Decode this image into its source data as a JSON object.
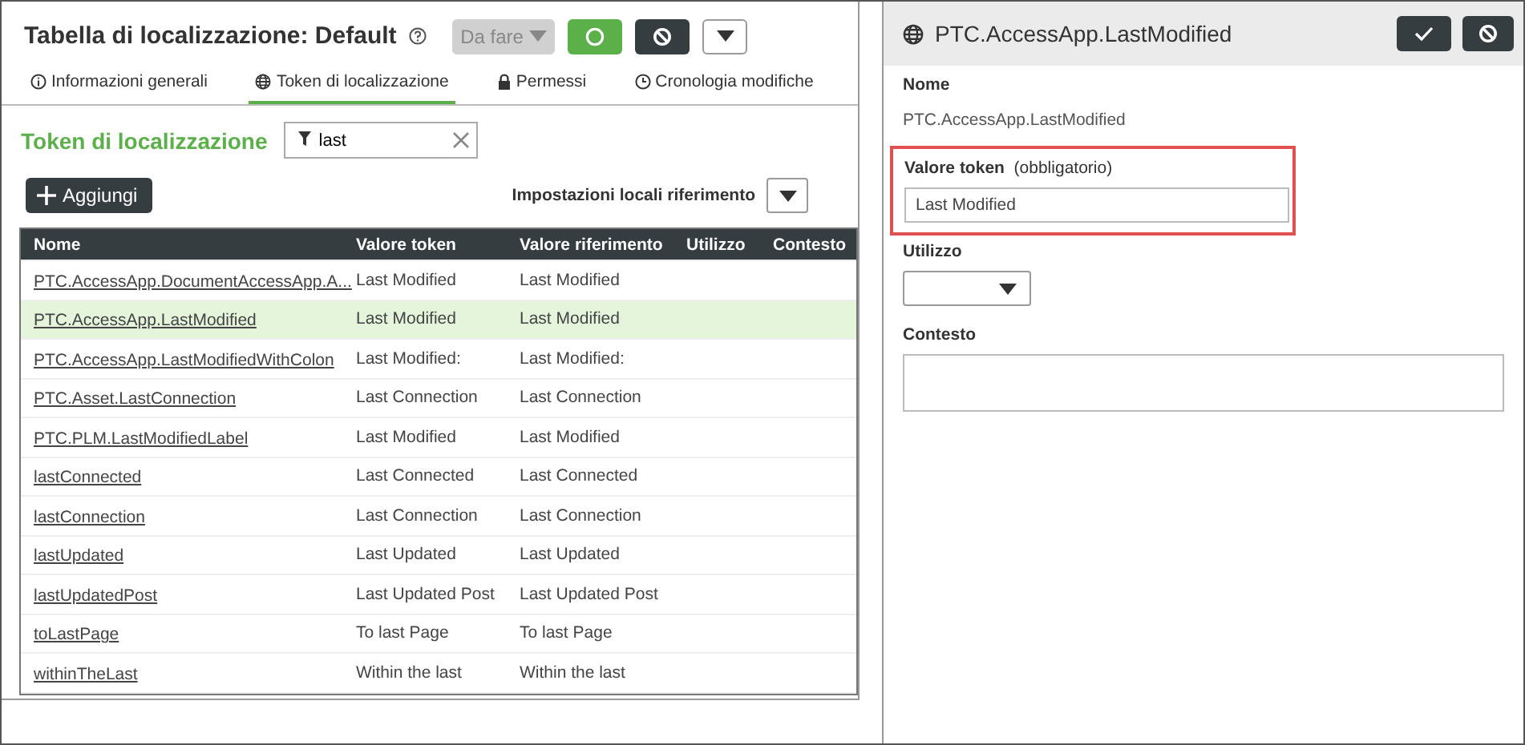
{
  "header": {
    "title": "Tabella di localizzazione: Default",
    "status": {
      "label": "Da fare",
      "disabled": true
    }
  },
  "tabs": [
    {
      "label": "Informazioni generali",
      "selected": false
    },
    {
      "label": "Token di localizzazione",
      "selected": true
    },
    {
      "label": "Permessi",
      "selected": false
    },
    {
      "label": "Cronologia modifiche",
      "selected": false
    }
  ],
  "section_title": "Token di localizzazione",
  "filter": {
    "value": "last"
  },
  "add_button": "Aggiungi",
  "reference_locale": {
    "label": "Impostazioni locali riferimento"
  },
  "table": {
    "columns": [
      "Nome",
      "Valore token",
      "Valore riferimento",
      "Utilizzo",
      "Contesto"
    ],
    "rows": [
      {
        "name": "PTC.AccessApp.DocumentAccessApp.A...",
        "token_value": "Last Modified",
        "reference_value": "Last Modified",
        "selected": false
      },
      {
        "name": "PTC.AccessApp.LastModified",
        "token_value": "Last Modified",
        "reference_value": "Last Modified",
        "selected": true
      },
      {
        "name": "PTC.AccessApp.LastModifiedWithColon",
        "token_value": "Last Modified:",
        "reference_value": "Last Modified:",
        "selected": false
      },
      {
        "name": "PTC.Asset.LastConnection",
        "token_value": "Last Connection",
        "reference_value": "Last Connection",
        "selected": false
      },
      {
        "name": "PTC.PLM.LastModifiedLabel",
        "token_value": "Last Modified",
        "reference_value": "Last Modified",
        "selected": false
      },
      {
        "name": "lastConnected",
        "token_value": "Last Connected",
        "reference_value": "Last Connected",
        "selected": false
      },
      {
        "name": "lastConnection",
        "token_value": "Last Connection",
        "reference_value": "Last Connection",
        "selected": false
      },
      {
        "name": "lastUpdated",
        "token_value": "Last Updated",
        "reference_value": "Last Updated",
        "selected": false
      },
      {
        "name": "lastUpdatedPost",
        "token_value": "Last Updated Post",
        "reference_value": "Last Updated Post",
        "selected": false
      },
      {
        "name": "toLastPage",
        "token_value": "To last Page",
        "reference_value": "To last Page",
        "selected": false
      },
      {
        "name": "withinTheLast",
        "token_value": "Within the last",
        "reference_value": "Within the last",
        "selected": false
      }
    ]
  },
  "detail": {
    "title": "PTC.AccessApp.LastModified",
    "name_label": "Nome",
    "name_value": "PTC.AccessApp.LastModified",
    "token_label": "Valore token",
    "token_hint": "(obbligatorio)",
    "token_value": "Last Modified",
    "highlighted": true,
    "usage_label": "Utilizzo",
    "context_label": "Contesto"
  }
}
